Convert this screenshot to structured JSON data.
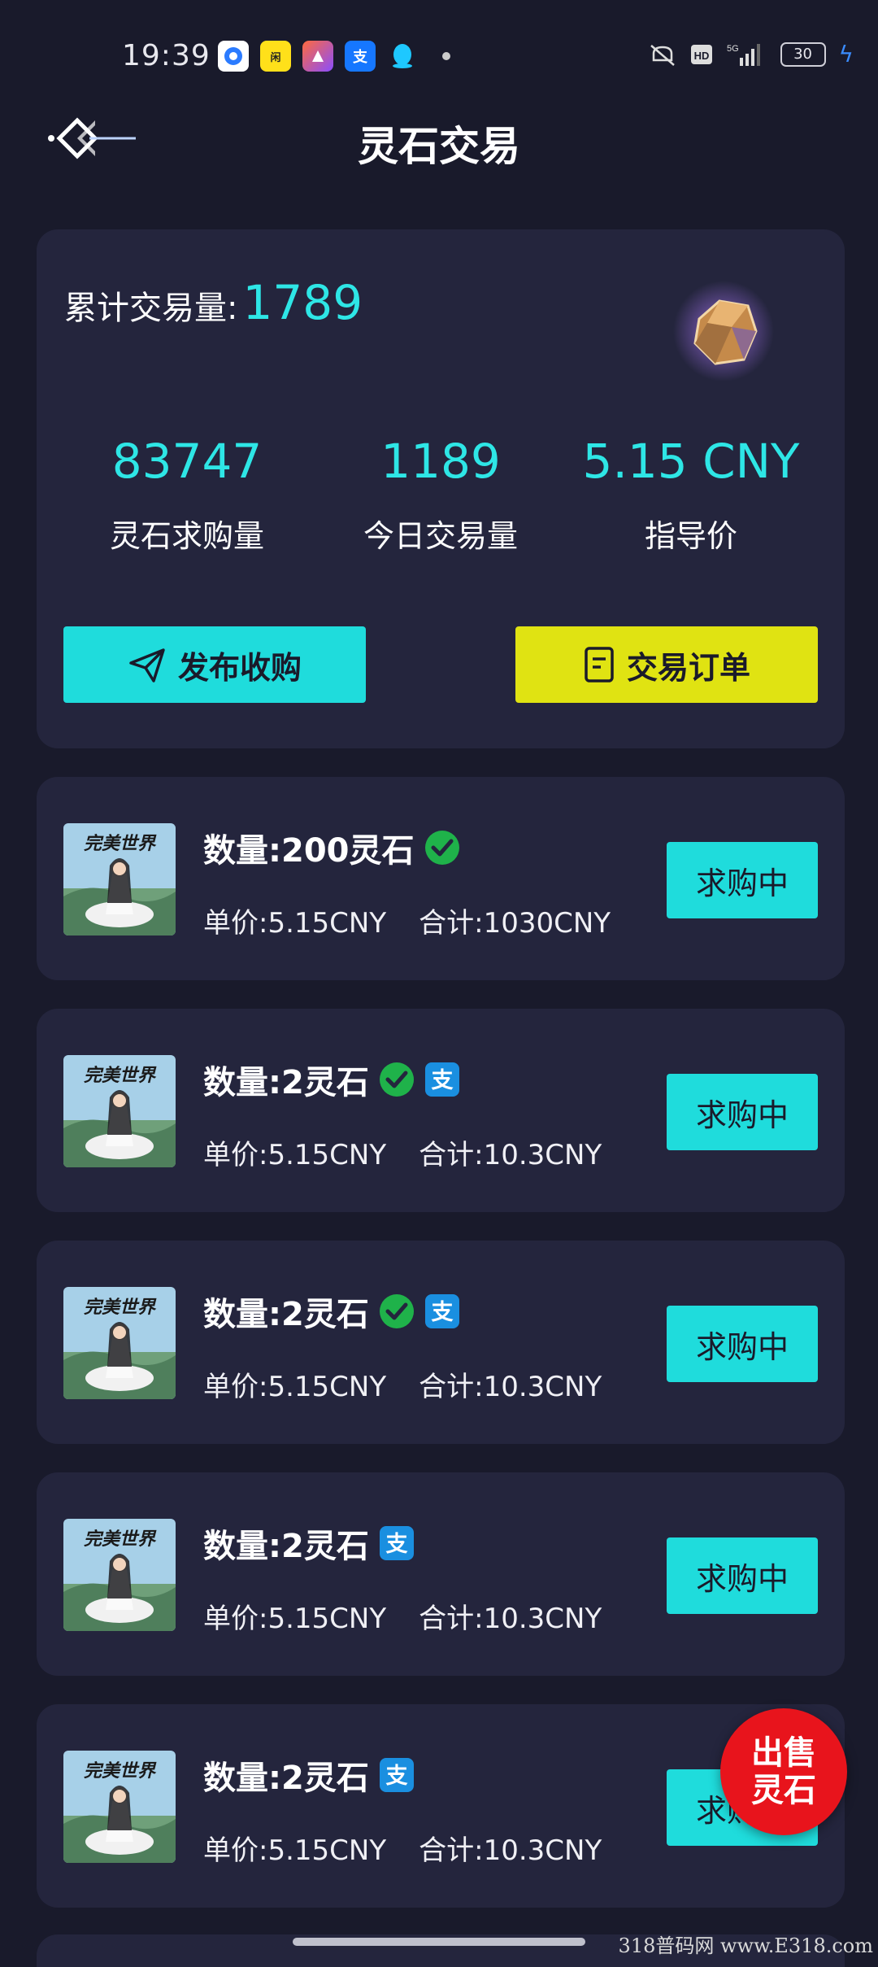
{
  "status_bar": {
    "time": "19:39",
    "battery": "30",
    "apps": [
      "browser-icon",
      "xianyu-icon",
      "pixel-icon",
      "alipay-icon",
      "qq-icon"
    ]
  },
  "header": {
    "title": "灵石交易"
  },
  "stats": {
    "total_label": "累计交易量:",
    "total_value": "1789",
    "items": [
      {
        "value": "83747",
        "label": "灵石求购量"
      },
      {
        "value": "1189",
        "label": "今日交易量"
      },
      {
        "value": "5.15 CNY",
        "label": "指导价"
      }
    ],
    "publish_label": "发布收购",
    "orders_label": "交易订单"
  },
  "listings": [
    {
      "qty": "数量:200灵石",
      "unit": "单价:5.15CNY",
      "total": "合计:1030CNY",
      "status": "求购中",
      "wechat": true,
      "alipay": false
    },
    {
      "qty": "数量:2灵石",
      "unit": "单价:5.15CNY",
      "total": "合计:10.3CNY",
      "status": "求购中",
      "wechat": true,
      "alipay": true
    },
    {
      "qty": "数量:2灵石",
      "unit": "单价:5.15CNY",
      "total": "合计:10.3CNY",
      "status": "求购中",
      "wechat": true,
      "alipay": true
    },
    {
      "qty": "数量:2灵石",
      "unit": "单价:5.15CNY",
      "total": "合计:10.3CNY",
      "status": "求购中",
      "wechat": false,
      "alipay": true
    },
    {
      "qty": "数量:2灵石",
      "unit": "单价:5.15CNY",
      "total": "合计:10.3CNY",
      "status": "求购中",
      "wechat": false,
      "alipay": true
    }
  ],
  "thumb_text": "完美世界",
  "sell_button": {
    "line1": "出售",
    "line2": "灵石"
  },
  "watermark": "318普码网 www.E318.com",
  "colors": {
    "accent": "#1fdcdc",
    "orders": "#e0e312",
    "sell": "#e8141c",
    "card": "#24253d",
    "bg": "#191a2b"
  }
}
